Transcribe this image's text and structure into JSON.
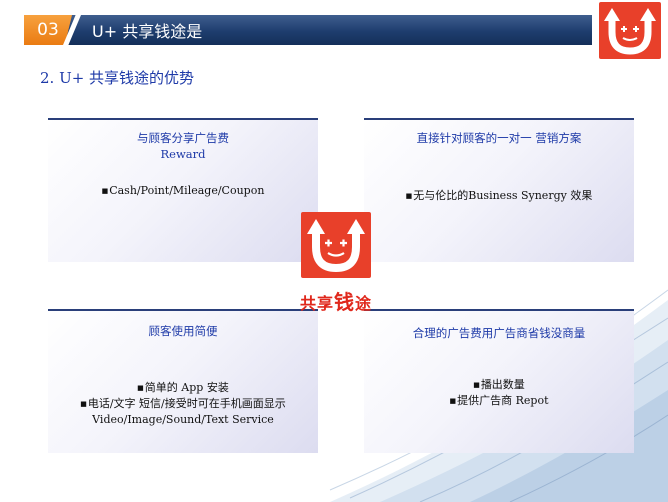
{
  "header": {
    "number": "03",
    "title": "U+ 共享钱途是"
  },
  "section_title": "2. U+ 共享钱途的优势",
  "panels": [
    {
      "title_lines": [
        "与顾客分享广告费",
        "Reward"
      ],
      "bullets": [
        "Cash/Point/Mileage/Coupon"
      ]
    },
    {
      "title_lines": [
        "直接针对顾客的一对一 营销方案"
      ],
      "bullets": [
        "无与伦比的Business Synergy 效果"
      ]
    },
    {
      "title_lines": [
        "顾客使用简便"
      ],
      "bullets": [
        "简单的 App 安装",
        "电话/文字 短信/接受时可在手机画面显示"
      ],
      "extra_line": "Video/Image/Sound/Text Service"
    },
    {
      "title_lines": [
        "合理的广告费用广告商省钱没商量"
      ],
      "bullets": [
        "播出数量",
        "提供广告商 Repot"
      ]
    }
  ],
  "brand": {
    "part1": "共享",
    "part2": "钱",
    "part3": "途"
  },
  "colors": {
    "header_bg": "#1e3d6e",
    "header_accent": "#f08a1c",
    "title_blue": "#1e3aa8",
    "brand_red": "#e8402a"
  },
  "icons": {
    "logo": "u-smile-logo-icon",
    "bullet": "square-bullet-icon"
  }
}
